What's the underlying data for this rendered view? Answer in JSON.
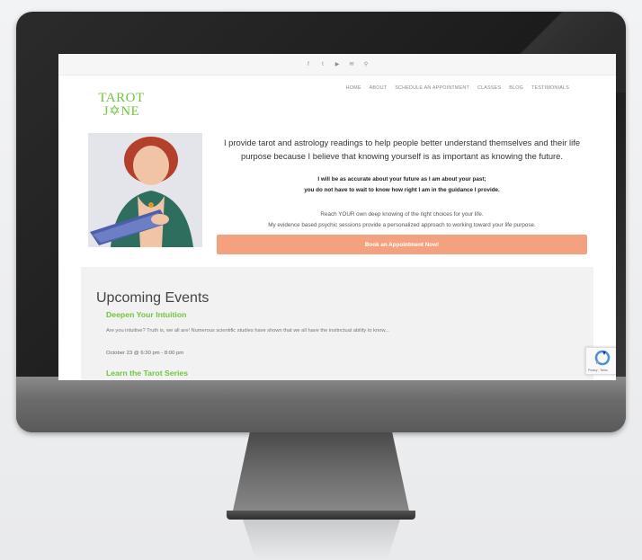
{
  "site": {
    "social_icons": [
      "facebook-icon",
      "twitter-icon",
      "youtube-icon",
      "mail-icon",
      "search-icon"
    ],
    "social_glyphs": [
      "f",
      "t",
      "▶",
      "✉",
      "⚲"
    ],
    "logo": {
      "line1": "TAROT",
      "line2": "J✡NE"
    },
    "nav": [
      "HOME",
      "ABOUT",
      "SCHEDULE AN APPOINTMENT",
      "CLASSES",
      "BLOG",
      "TESTIMONIALS"
    ],
    "intro": "I provide tarot and astrology readings to help people better understand themselves and their life purpose because I believe that knowing yourself is as important as knowing the future.",
    "accuracy_line1": "I will be as accurate about your future as I am about your past;",
    "accuracy_line2": "you do not have to wait to know how right I am in the guidance I provide.",
    "reach_line1": "Reach YOUR own deep knowing of the right choices for your life.",
    "reach_line2": "My evidence based psychic sessions provide a personalized approach to working toward your life purpose.",
    "book_button": "Book an Appointment Now!",
    "events_title": "Upcoming Events",
    "events": [
      {
        "title": "Deepen Your Intuition",
        "description": "Are you intuitive? Truth is, we all are! Numerous scientific studies have shown that we all have the instinctual ability to know...",
        "date": "October 23 @ 6:30 pm - 8:00 pm"
      },
      {
        "title": "Learn the Tarot Series"
      }
    ],
    "recaptcha_text": "Privacy - Terms"
  },
  "colors": {
    "brand_green": "#6fc63d",
    "button_peach": "#f4a17f"
  }
}
